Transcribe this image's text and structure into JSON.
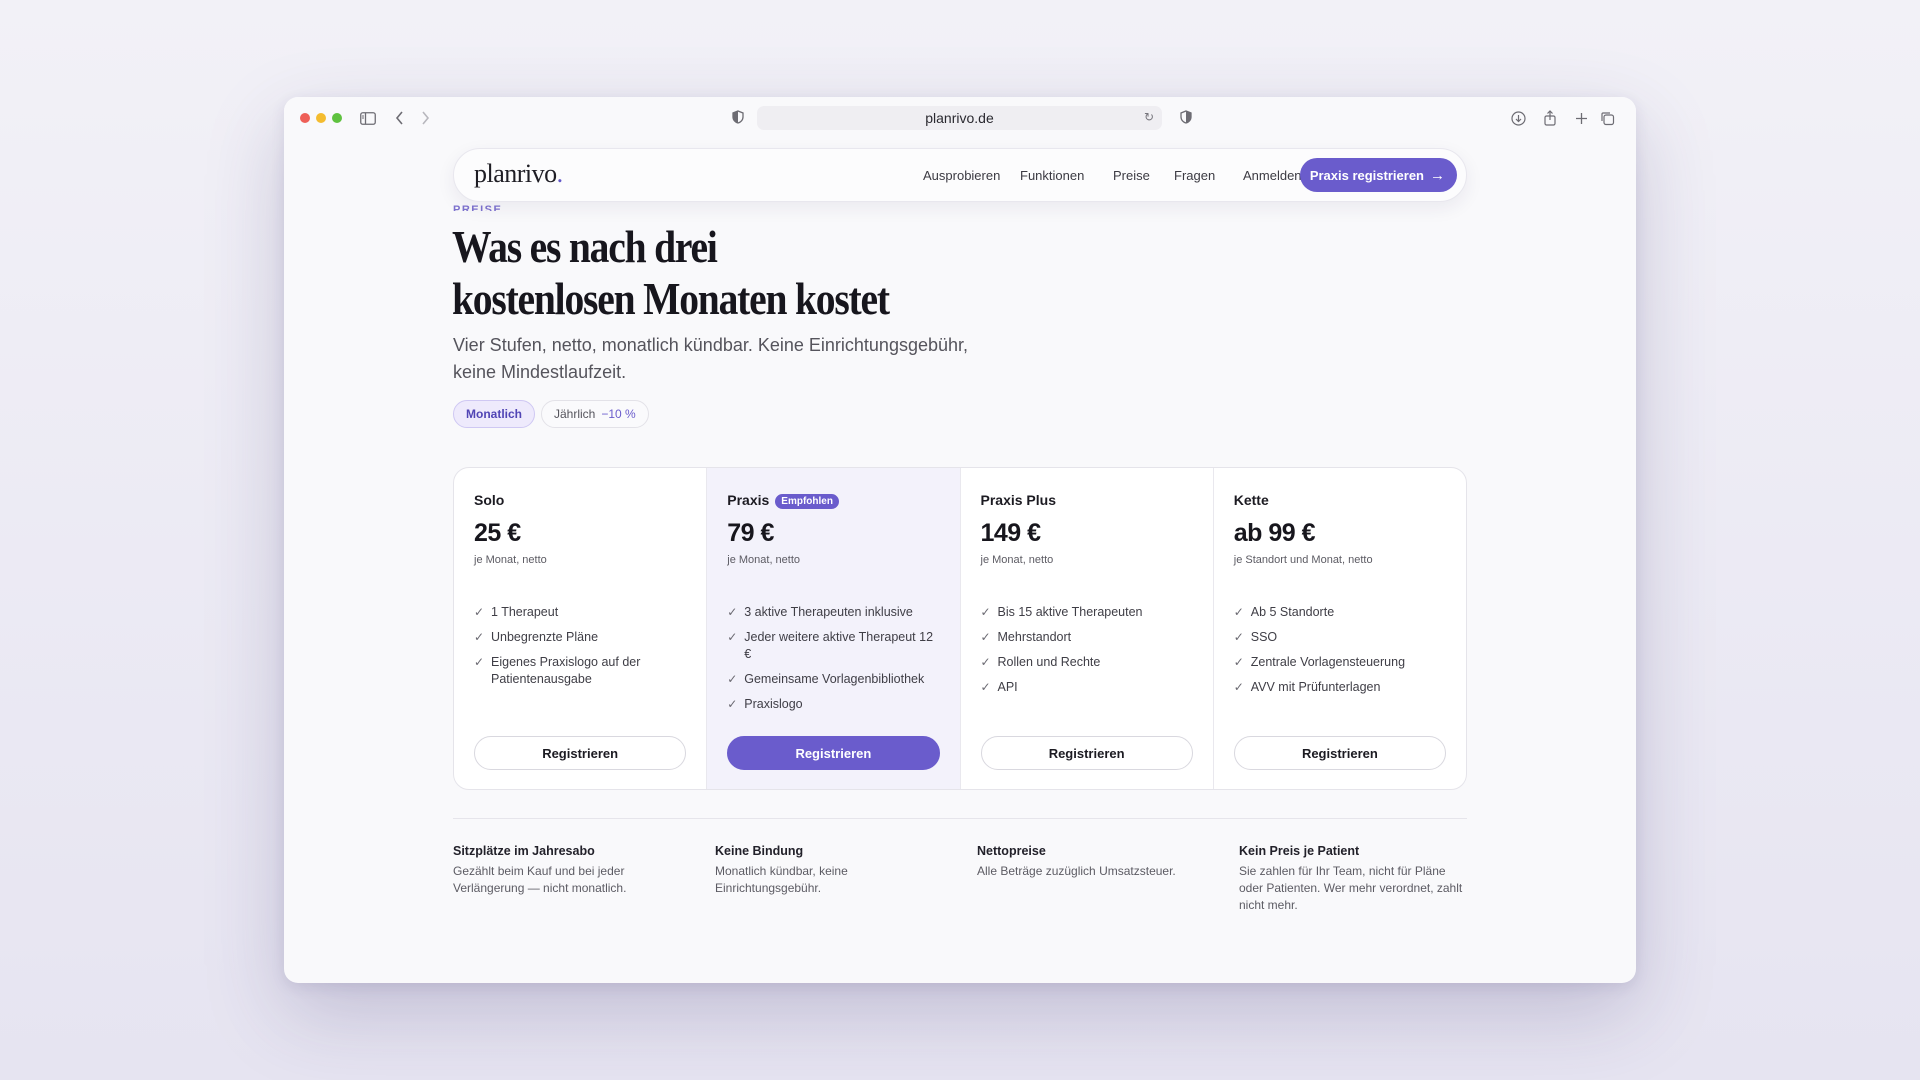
{
  "browser": {
    "url": "planrivo.de"
  },
  "nav": {
    "logo_text": "planrivo",
    "logo_dot": ".",
    "links": [
      "Ausprobieren",
      "Funktionen",
      "Preise",
      "Fragen",
      "Anmelden"
    ],
    "cta_label": "Praxis registrieren",
    "cta_icon": "arrow-right-icon"
  },
  "hero": {
    "eyebrow": "PREISE",
    "headline_line1": "Was es nach drei",
    "headline_line2": "kostenlosen Monaten kostet",
    "subtext": "Vier Stufen, netto, monatlich kündbar. Keine Einrichtungsgebühr, keine Mindestlaufzeit."
  },
  "billing_toggle": {
    "monthly_label": "Monatlich",
    "yearly_label": "Jährlich",
    "yearly_discount": "−10 %",
    "selected": "Monatlich"
  },
  "plans": [
    {
      "name": "Solo",
      "badge": "",
      "price": "25 €",
      "period": "je Monat, netto",
      "features": [
        "1 Therapeut",
        "Unbegrenzte Pläne",
        "Eigenes Praxislogo auf der Patientenausgabe"
      ],
      "button_label": "Registrieren"
    },
    {
      "name": "Praxis",
      "badge": "Empfohlen",
      "price": "79 €",
      "period": "je Monat, netto",
      "features": [
        "3 aktive Therapeuten inklusive",
        "Jeder weitere aktive Therapeut 12 €",
        "Gemeinsame Vorlagenbibliothek",
        "Praxislogo"
      ],
      "button_label": "Registrieren"
    },
    {
      "name": "Praxis Plus",
      "badge": "",
      "price": "149 €",
      "period": "je Monat, netto",
      "features": [
        "Bis 15 aktive Therapeuten",
        "Mehrstandort",
        "Rollen und Rechte",
        "API"
      ],
      "button_label": "Registrieren"
    },
    {
      "name": "Kette",
      "badge": "",
      "price": "ab 99 €",
      "period": "je Standort und Monat, netto",
      "features": [
        "Ab 5 Standorte",
        "SSO",
        "Zentrale Vorlagensteuerung",
        "AVV mit Prüfunterlagen"
      ],
      "button_label": "Registrieren"
    }
  ],
  "info": [
    {
      "title": "Sitzplätze im Jahresabo",
      "text": "Gezählt beim Kauf und bei jeder Verlängerung — nicht monatlich."
    },
    {
      "title": "Keine Bindung",
      "text": "Monatlich kündbar, keine Einrichtungsgebühr."
    },
    {
      "title": "Nettopreise",
      "text": "Alle Beträge zuzüglich Umsatzsteuer."
    },
    {
      "title": "Kein Preis je Patient",
      "text": "Sie zahlen für Ihr Team, nicht für Pläne oder Patienten. Wer mehr verordnet, zahlt nicht mehr."
    }
  ],
  "colors": {
    "accent": "#6a5ccc",
    "featured_bg": "#f3f2fb"
  }
}
